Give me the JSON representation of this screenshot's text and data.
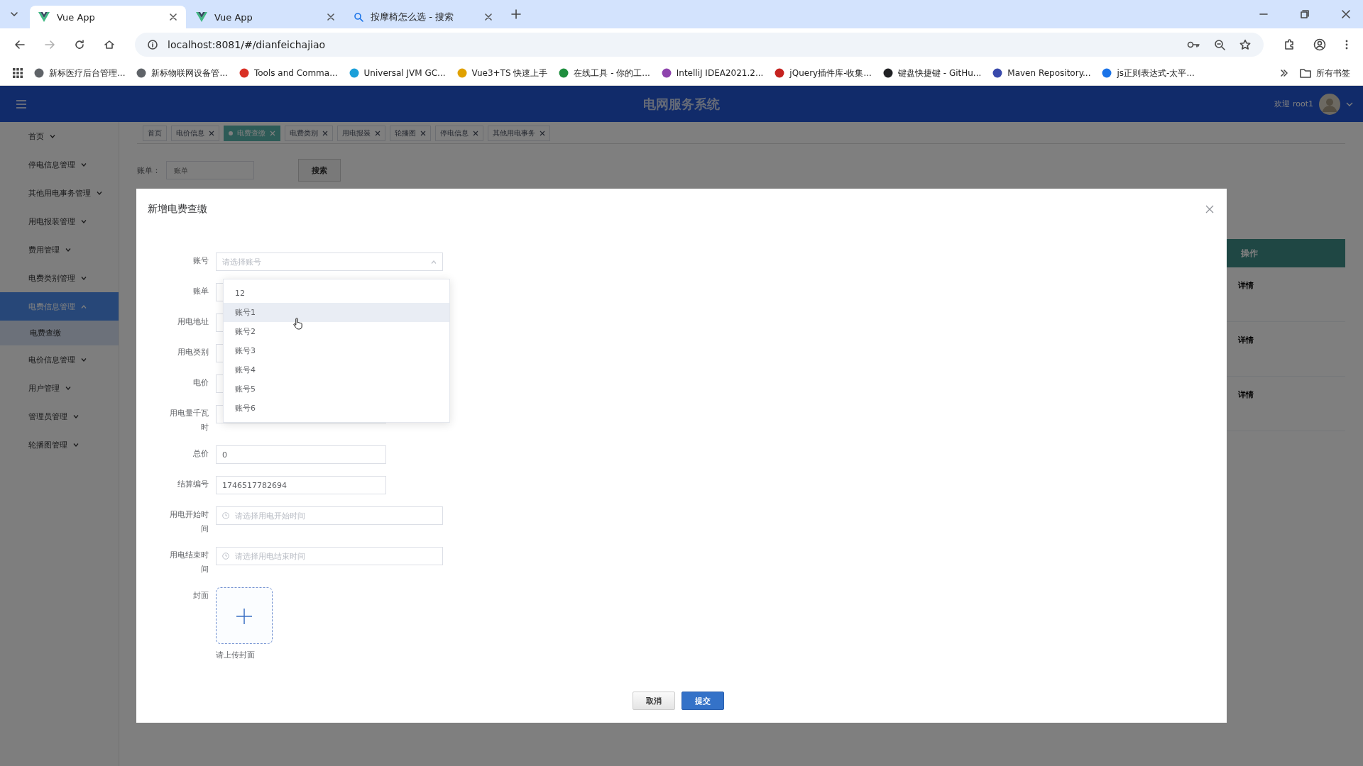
{
  "browser": {
    "tabs": [
      {
        "title": "Vue App",
        "selected": true,
        "kind": "vue"
      },
      {
        "title": "Vue App",
        "selected": false,
        "kind": "vue"
      },
      {
        "title": "按摩椅怎么选 - 搜索",
        "selected": false,
        "kind": "search"
      }
    ],
    "address": "localhost:8081/#/dianfeichajiao",
    "bookmarks": [
      {
        "label": "新标医疗后台管理...",
        "color": "#5f6368"
      },
      {
        "label": "新标物联网设备管...",
        "color": "#5f6368"
      },
      {
        "label": "Tools and Comma...",
        "color": "#d93025"
      },
      {
        "label": "Universal JVM GC...",
        "color": "#1a9fd9"
      },
      {
        "label": "Vue3+TS 快速上手",
        "color": "#e0a100"
      },
      {
        "label": "在线工具 - 你的工...",
        "color": "#1e8e3e"
      },
      {
        "label": "IntelliJ IDEA2021.2...",
        "color": "#8e44ad"
      },
      {
        "label": "jQuery插件库-收集...",
        "color": "#c5221f"
      },
      {
        "label": "键盘快捷键 - GitHu...",
        "color": "#202124"
      },
      {
        "label": "Maven Repository...",
        "color": "#3949ab"
      },
      {
        "label": "js正则表达式-太平...",
        "color": "#1a73e8"
      }
    ],
    "all_bookmarks": "所有书签"
  },
  "app": {
    "title": "电网服务系统",
    "welcome": "欢迎 root1",
    "sidebar": {
      "items": [
        {
          "label": "首页",
          "expanded": false,
          "selected": false
        },
        {
          "label": "停电信息管理",
          "expanded": false,
          "selected": false
        },
        {
          "label": "其他用电事务管理",
          "expanded": false,
          "selected": false
        },
        {
          "label": "用电报装管理",
          "expanded": false,
          "selected": false
        },
        {
          "label": "费用管理",
          "expanded": false,
          "selected": false
        },
        {
          "label": "电费类别管理",
          "expanded": false,
          "selected": false
        },
        {
          "label": "电费信息管理",
          "expanded": true,
          "selected": true,
          "children": [
            {
              "label": "电费查缴",
              "selected": true
            }
          ]
        },
        {
          "label": "电价信息管理",
          "expanded": false,
          "selected": false
        },
        {
          "label": "用户管理",
          "expanded": false,
          "selected": false
        },
        {
          "label": "管理员管理",
          "expanded": false,
          "selected": false
        },
        {
          "label": "轮播图管理",
          "expanded": false,
          "selected": false
        }
      ]
    },
    "tags": [
      {
        "label": "首页",
        "selected": false,
        "closable": false
      },
      {
        "label": "电价信息",
        "selected": false,
        "closable": true
      },
      {
        "label": "电费查缴",
        "selected": true,
        "closable": true
      },
      {
        "label": "电费类别",
        "selected": false,
        "closable": true
      },
      {
        "label": "用电报装",
        "selected": false,
        "closable": true
      },
      {
        "label": "轮播图",
        "selected": false,
        "closable": true
      },
      {
        "label": "停电信息",
        "selected": false,
        "closable": true
      },
      {
        "label": "其他用电事务",
        "selected": false,
        "closable": true
      }
    ],
    "search": {
      "label": "账单：",
      "placeholder": "账单",
      "button": "搜索"
    },
    "table": {
      "columns": [
        "操作"
      ],
      "rows": [
        {
          "action": "详情"
        },
        {
          "action": "详情"
        },
        {
          "action": "详情"
        }
      ]
    }
  },
  "dialog": {
    "title": "新增电费查缴",
    "fields": [
      {
        "label": "账号",
        "kind": "select",
        "placeholder": "请选择账号",
        "open": true
      },
      {
        "label": "账单",
        "kind": "input"
      },
      {
        "label": "用电地址",
        "kind": "input"
      },
      {
        "label": "用电类别",
        "kind": "input"
      },
      {
        "label": "电价",
        "kind": "input"
      },
      {
        "label": "用电量千瓦时",
        "kind": "input"
      },
      {
        "label": "总价",
        "kind": "input",
        "value": "0"
      },
      {
        "label": "结算编号",
        "kind": "input",
        "value": "1746517782694"
      },
      {
        "label": "用电开始时间",
        "kind": "date",
        "placeholder": "请选择用电开始时间"
      },
      {
        "label": "用电结束时间",
        "kind": "date",
        "placeholder": "请选择用电结束时间"
      },
      {
        "label": "封面",
        "kind": "upload",
        "hint": "请上传封面"
      }
    ],
    "options": [
      {
        "label": "12",
        "hovered": false
      },
      {
        "label": "账号1",
        "hovered": true
      },
      {
        "label": "账号2",
        "hovered": false
      },
      {
        "label": "账号3",
        "hovered": false
      },
      {
        "label": "账号4",
        "hovered": false
      },
      {
        "label": "账号5",
        "hovered": false
      },
      {
        "label": "账号6",
        "hovered": false
      }
    ],
    "buttons": [
      {
        "label": "取消",
        "kind": "cancel"
      },
      {
        "label": "提交",
        "kind": "primary"
      }
    ]
  }
}
